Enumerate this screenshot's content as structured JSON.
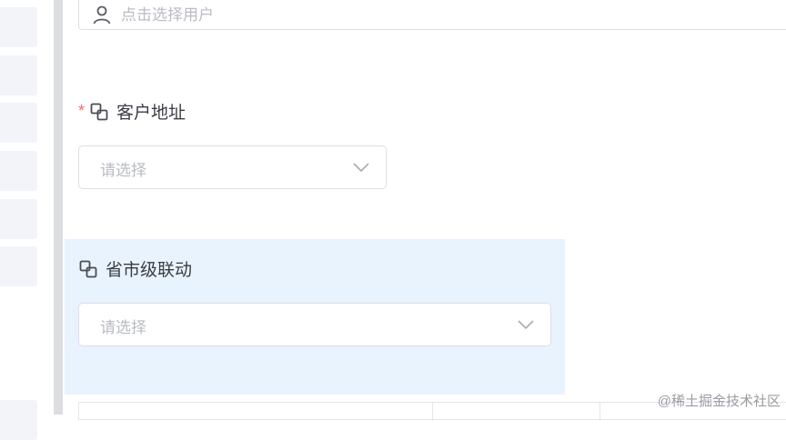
{
  "user_select": {
    "placeholder": "点击选择用户",
    "icon": "user-icon"
  },
  "address_field": {
    "required_mark": "*",
    "icon": "link-icon",
    "label": "客户地址",
    "placeholder": "请选择",
    "dropdown_icon": "chevron-down-icon"
  },
  "cascade_field": {
    "icon": "link-icon",
    "label": "省市级联动",
    "placeholder": "请选择",
    "dropdown_icon": "chevron-down-icon",
    "highlight_color": "#e9f3fd"
  },
  "watermark": "@稀土掘金技术社区",
  "colors": {
    "required": "#f56c6c",
    "placeholder": "#b9bcc3",
    "label": "#3a3d44",
    "border": "#dcdfe6"
  }
}
